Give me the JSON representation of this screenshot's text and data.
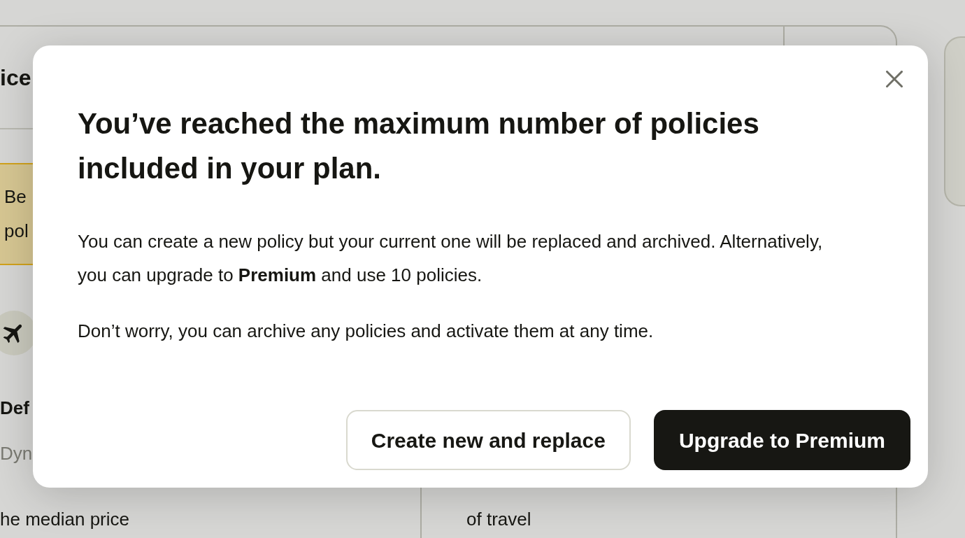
{
  "page": {
    "header": {
      "title": "ice"
    },
    "notice": {
      "lines": [
        "Be",
        "pol"
      ]
    },
    "policy": {
      "name": "Def",
      "subtitle": "Dyn",
      "rules": [
        {
          "lines": [
            "he median price"
          ]
        },
        {
          "lines": [
            "of travel"
          ]
        }
      ]
    }
  },
  "dialog": {
    "title": "You’ve reached the maximum number of policies included in your plan.",
    "paragraphs": [
      "You can create a new policy but your current one will be replaced and archived. Alternatively, you can upgrade to **Premium** and use 10 policies.",
      "Don’t worry, you can archive any policies and activate them at any time."
    ],
    "buttons": [
      {
        "label": "Create new and replace",
        "kind": "secondary"
      },
      {
        "label": "Upgrade to Premium",
        "kind": "primary"
      }
    ]
  }
}
